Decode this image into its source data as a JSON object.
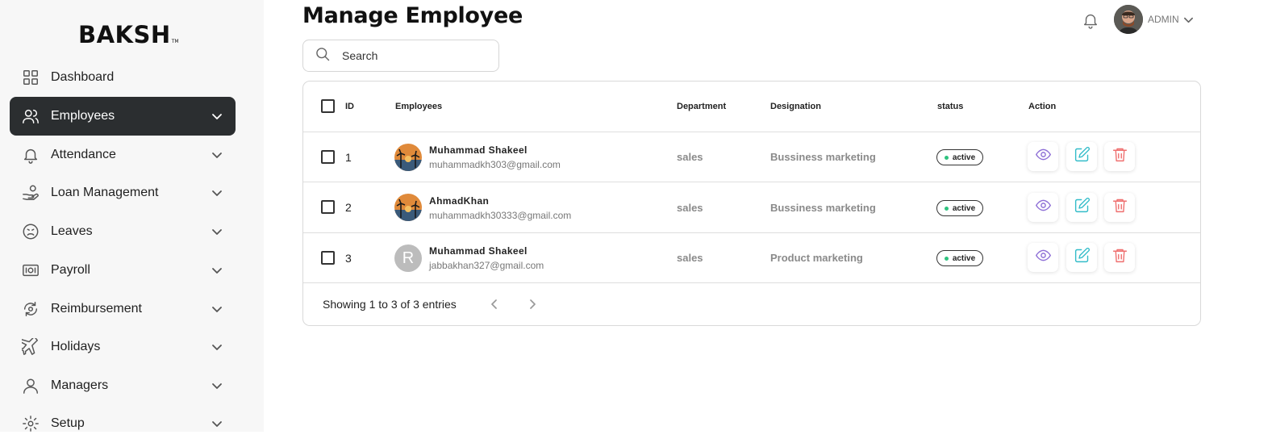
{
  "brand": {
    "name": "BAKSH",
    "tm": "TM"
  },
  "sidebar": {
    "items": [
      {
        "label": "Dashboard",
        "icon": "grid-icon"
      },
      {
        "label": "Employees",
        "icon": "users-icon"
      },
      {
        "label": "Attendance",
        "icon": "bell-icon"
      },
      {
        "label": "Loan Management",
        "icon": "hand-coins-icon"
      },
      {
        "label": "Leaves",
        "icon": "sad-face-icon"
      },
      {
        "label": "Payroll",
        "icon": "payroll-icon"
      },
      {
        "label": "Reimbursement",
        "icon": "refund-icon"
      },
      {
        "label": "Holidays",
        "icon": "plane-icon"
      },
      {
        "label": "Managers",
        "icon": "user-icon"
      },
      {
        "label": "Setup",
        "icon": "gear-icon"
      }
    ],
    "active_label": "Employees"
  },
  "header": {
    "title": "Manage Employee",
    "search_placeholder": "Search",
    "user_label": "ADMIN"
  },
  "table": {
    "columns": [
      "ID",
      "Employees",
      "Department",
      "Designation",
      "status",
      "Action"
    ],
    "rows": [
      {
        "id": "1",
        "name": "Muhammad Shakeel",
        "email": "muhammadkh303@gmail.com",
        "department": "sales",
        "designation": "Bussiness marketing",
        "status": "active",
        "avatar": "photo",
        "initial": ""
      },
      {
        "id": "2",
        "name": "AhmadKhan",
        "email": "muhammadkh30333@gmail.com",
        "department": "sales",
        "designation": "Bussiness marketing",
        "status": "active",
        "avatar": "photo",
        "initial": ""
      },
      {
        "id": "3",
        "name": "Muhammad Shakeel",
        "email": "jabbakhan327@gmail.com",
        "department": "sales",
        "designation": "Product marketing",
        "status": "active",
        "avatar": "initial",
        "initial": "R"
      }
    ],
    "footer": "Showing 1 to 3 of 3 entries"
  },
  "colors": {
    "sidebar_bg": "#f7f7f7",
    "active_nav_bg": "#2b2e30",
    "status_dot": "#2ec27e",
    "view_icon": "#8e6fd6",
    "edit_icon": "#33bcc9",
    "delete_icon": "#ef6f6f"
  }
}
